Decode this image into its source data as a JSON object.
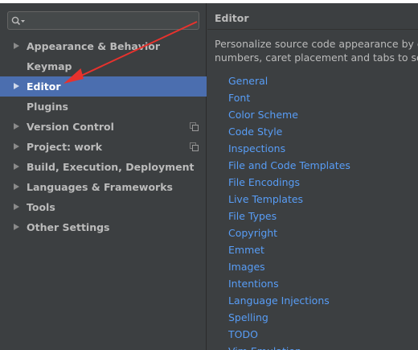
{
  "search": {
    "value": "",
    "placeholder": ""
  },
  "sidebar": {
    "items": [
      {
        "label": "Appearance & Behavior",
        "has_arrow": true,
        "selected": false,
        "copy_icon": false
      },
      {
        "label": "Keymap",
        "has_arrow": false,
        "selected": false,
        "copy_icon": false
      },
      {
        "label": "Editor",
        "has_arrow": true,
        "selected": true,
        "copy_icon": false
      },
      {
        "label": "Plugins",
        "has_arrow": false,
        "selected": false,
        "copy_icon": false
      },
      {
        "label": "Version Control",
        "has_arrow": true,
        "selected": false,
        "copy_icon": true
      },
      {
        "label": "Project: work",
        "has_arrow": true,
        "selected": false,
        "copy_icon": true
      },
      {
        "label": "Build, Execution, Deployment",
        "has_arrow": true,
        "selected": false,
        "copy_icon": false
      },
      {
        "label": "Languages & Frameworks",
        "has_arrow": true,
        "selected": false,
        "copy_icon": false
      },
      {
        "label": "Tools",
        "has_arrow": true,
        "selected": false,
        "copy_icon": false
      },
      {
        "label": "Other Settings",
        "has_arrow": true,
        "selected": false,
        "copy_icon": false
      }
    ]
  },
  "main": {
    "title": "Editor",
    "description_line1": "Personalize source code appearance by ch",
    "description_line2": "numbers, caret placement and tabs to sour",
    "links": [
      "General",
      "Font",
      "Color Scheme",
      "Code Style",
      "Inspections",
      "File and Code Templates",
      "File Encodings",
      "Live Templates",
      "File Types",
      "Copyright",
      "Emmet",
      "Images",
      "Intentions",
      "Language Injections",
      "Spelling",
      "TODO",
      "Vim Emulation"
    ]
  },
  "colors": {
    "background": "#3c3f41",
    "selection": "#4b6eaf",
    "link": "#589df6",
    "text": "#bbbbbb",
    "annotation": "#e8322d"
  },
  "icons": {
    "search": "search-icon",
    "expand": "chevron-right-icon",
    "copy": "copy-icon",
    "annotation": "arrow-icon"
  }
}
